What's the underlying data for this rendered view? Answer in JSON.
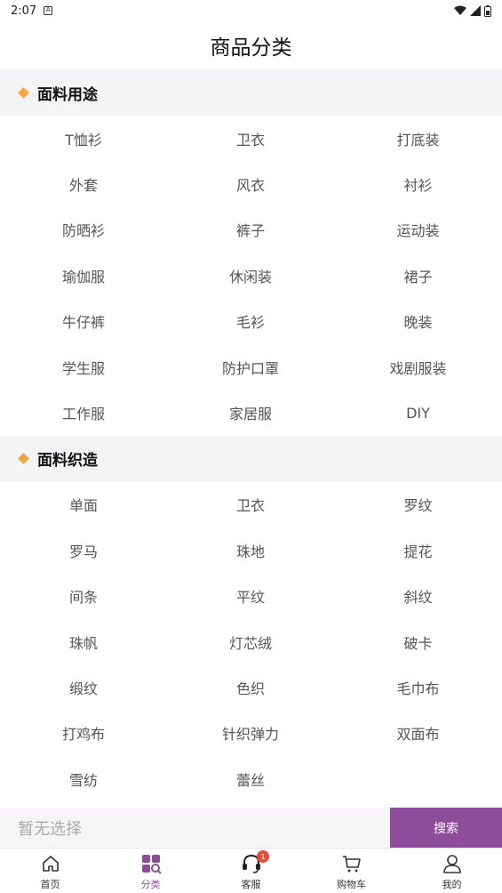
{
  "status": {
    "time": "2:07"
  },
  "header": {
    "title": "商品分类"
  },
  "sections": [
    {
      "title": "面料用途",
      "items": [
        "T恤衫",
        "卫衣",
        "打底装",
        "外套",
        "风衣",
        "衬衫",
        "防晒衫",
        "裤子",
        "运动装",
        "瑜伽服",
        "休闲装",
        "裙子",
        "牛仔裤",
        "毛衫",
        "晚装",
        "学生服",
        "防护口罩",
        "戏剧服装",
        "工作服",
        "家居服",
        "DIY"
      ]
    },
    {
      "title": "面料织造",
      "items": [
        "单面",
        "卫衣",
        "罗纹",
        "罗马",
        "珠地",
        "提花",
        "间条",
        "平纹",
        "斜纹",
        "珠帆",
        "灯芯绒",
        "破卡",
        "缎纹",
        "色织",
        "毛巾布",
        "打鸡布",
        "针织弹力",
        "双面布",
        "雪纺",
        "蕾丝"
      ]
    }
  ],
  "search": {
    "placeholder": "暂无选择",
    "button_label": "搜索"
  },
  "tabbar": {
    "items": [
      {
        "label": "首页",
        "icon": "home-icon"
      },
      {
        "label": "分类",
        "icon": "category-icon"
      },
      {
        "label": "客服",
        "icon": "headset-icon",
        "badge": "1"
      },
      {
        "label": "购物车",
        "icon": "cart-icon"
      },
      {
        "label": "我的",
        "icon": "user-icon"
      }
    ]
  },
  "colors": {
    "accent": "#8e4d9a",
    "diamond": "#f4a53d",
    "badge": "#e74c3c"
  }
}
